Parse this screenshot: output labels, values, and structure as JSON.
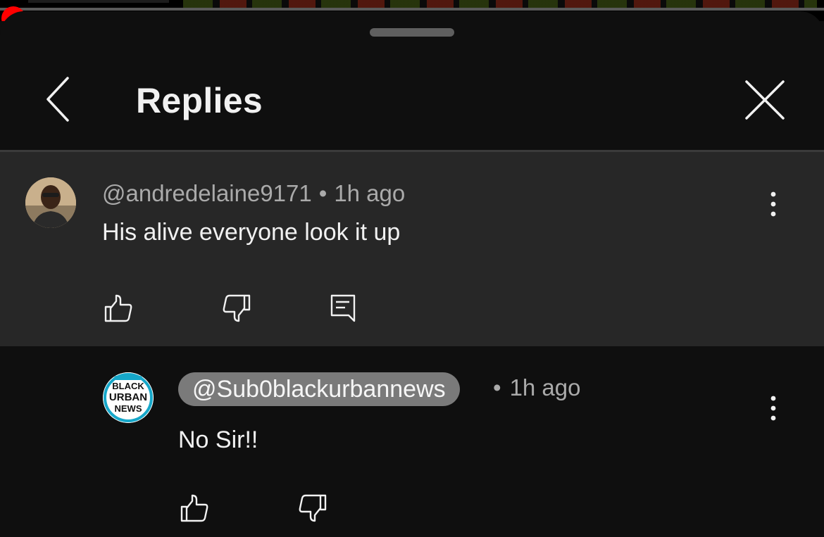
{
  "header": {
    "title": "Replies"
  },
  "parent_comment": {
    "author": "@andredelaine9171",
    "separator": "•",
    "time": "1h ago",
    "text": "His alive everyone look it up"
  },
  "reply": {
    "author": "@Sub0blackurbannews",
    "separator": "•",
    "time": "1h ago",
    "text": "No Sir!!",
    "avatar_logo_text": [
      "BLACK",
      "URBAN",
      "NEWS"
    ]
  },
  "icons": {
    "back": "chevron-left-icon",
    "close": "close-icon",
    "more": "more-vertical-icon",
    "like": "thumbs-up-icon",
    "dislike": "thumbs-down-icon",
    "reply": "reply-comment-icon"
  },
  "colors": {
    "background": "#0f0f0f",
    "highlight_background": "#272727",
    "progress": "#ff0000",
    "secondary_text": "#aaaaaa",
    "handle_pill": "#7a7a7a"
  }
}
